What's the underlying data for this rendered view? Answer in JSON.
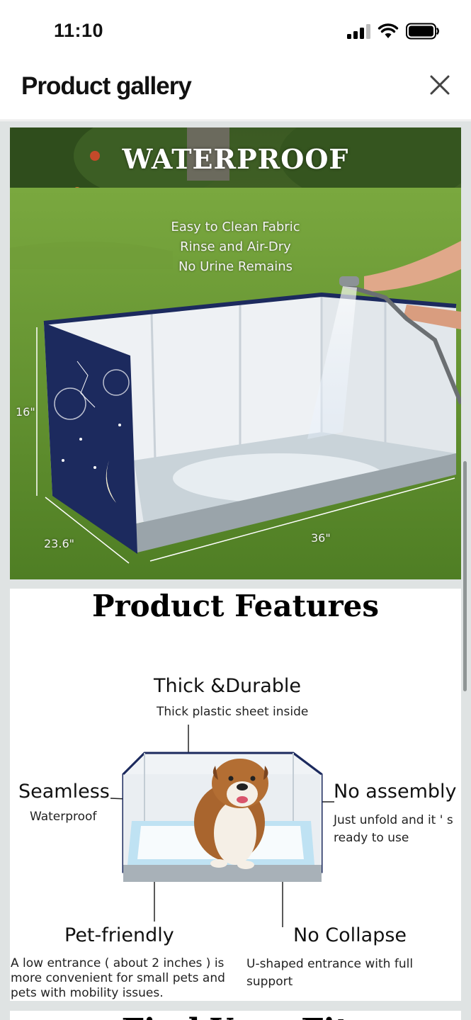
{
  "status": {
    "time": "11:10"
  },
  "header": {
    "title": "Product gallery"
  },
  "panel1": {
    "title": "WATERPROOF",
    "lines": [
      "Easy to Clean Fabric",
      "Rinse and Air-Dry",
      "No Urine Remains"
    ],
    "dims": {
      "height": "16\"",
      "width": "23.6\"",
      "length": "36\""
    }
  },
  "panel2": {
    "title": "Product Features",
    "features": {
      "thick": {
        "heading": "Thick &Durable",
        "sub": "Thick plastic sheet inside"
      },
      "seamless": {
        "heading": "Seamless",
        "sub": "Waterproof"
      },
      "noassembly": {
        "heading": "No assembly",
        "sub1": "Just unfold and it ' s",
        "sub2": "ready to use"
      },
      "petfriendly": {
        "heading": "Pet-friendly",
        "p1": "A low entrance ( about 2 inches ) is",
        "p2": "more convenient for small pets and",
        "p3": "pets with mobility issues."
      },
      "nocollapse": {
        "heading": "No Collapse",
        "sub": "U-shaped entrance with full support"
      }
    }
  },
  "panel3": {
    "title": "Find Your Fit"
  },
  "colors": {
    "navy": "#1c2a5e",
    "grass": "#5c8a2c",
    "pad": "#e9f2f7"
  }
}
